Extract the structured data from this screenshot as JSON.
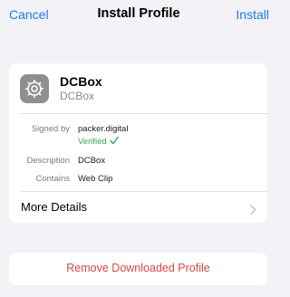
{
  "nav": {
    "cancel": "Cancel",
    "title": "Install Profile",
    "install": "Install"
  },
  "profile": {
    "name": "DCBox",
    "subtitle": "DCBox",
    "icon": "gear-icon"
  },
  "details": {
    "signed_by_label": "Signed by",
    "signed_by_value": "packer.digital",
    "verified": "Verified",
    "verified_icon": "checkmark-icon",
    "description_label": "Description",
    "description_value": "DCBox",
    "contains_label": "Contains",
    "contains_value": "Web Clip"
  },
  "more_details": "More Details",
  "remove": "Remove Downloaded Profile",
  "colors": {
    "accent": "#1a7cf5",
    "verified": "#34a853",
    "destructive": "#e0443b"
  }
}
